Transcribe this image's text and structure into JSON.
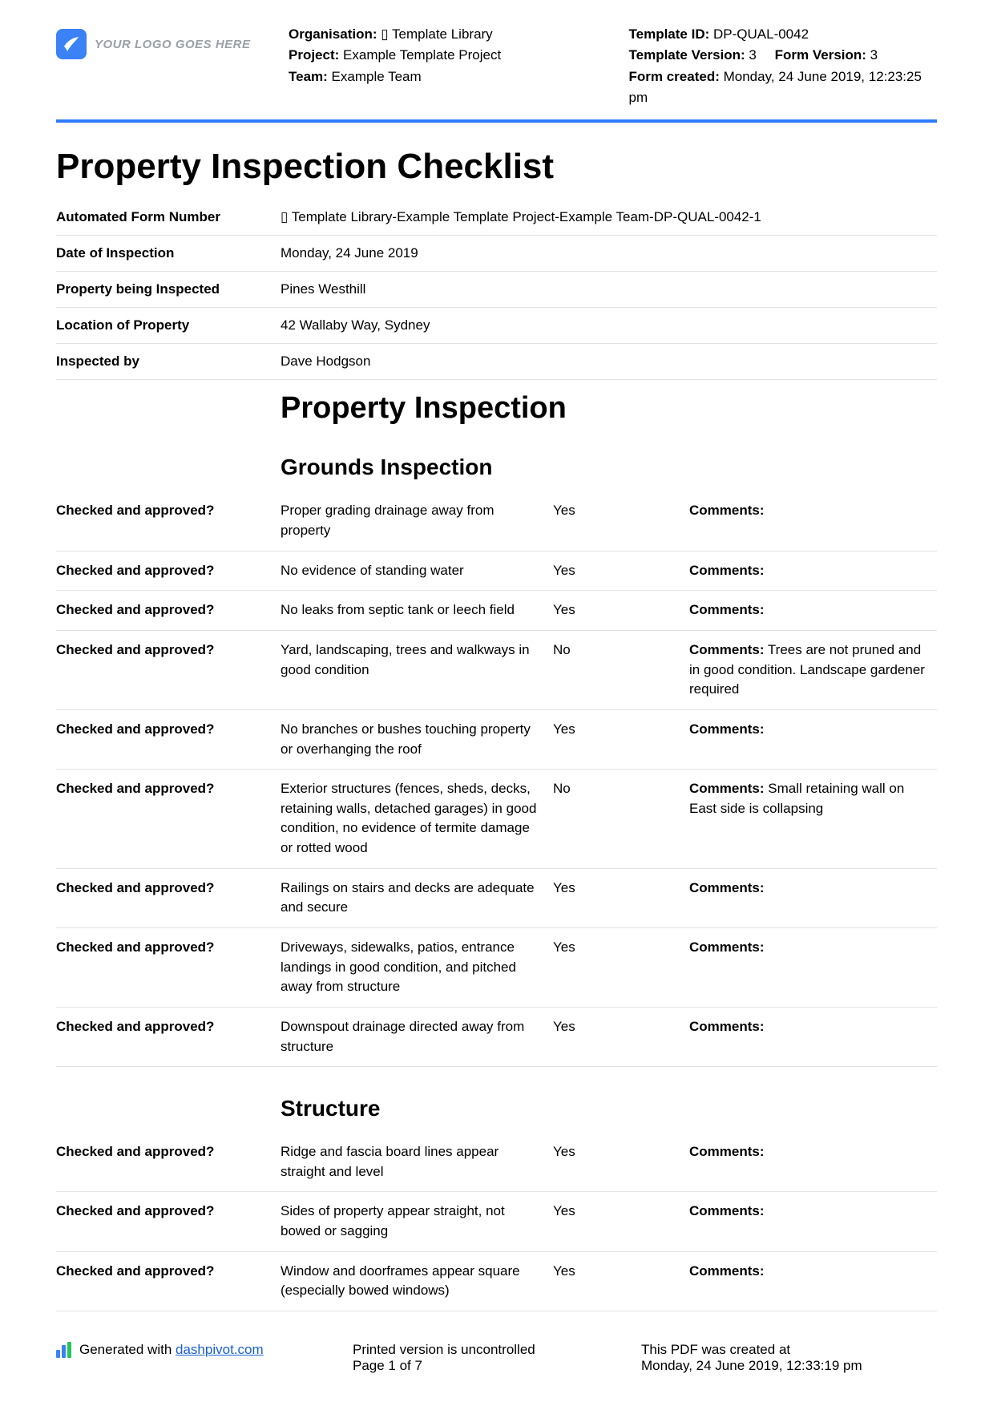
{
  "logo_text": "YOUR LOGO GOES HERE",
  "header": {
    "left": {
      "org_label": "Organisation:",
      "org_value": "▯ Template Library",
      "project_label": "Project:",
      "project_value": "Example Template Project",
      "team_label": "Team:",
      "team_value": "Example Team"
    },
    "right": {
      "tid_label": "Template ID:",
      "tid_value": "DP-QUAL-0042",
      "tver_label": "Template Version:",
      "tver_value": "3",
      "fver_label": "Form Version:",
      "fver_value": "3",
      "created_label": "Form created:",
      "created_value": "Monday, 24 June 2019, 12:23:25 pm"
    }
  },
  "page_title": "Property Inspection Checklist",
  "info": [
    {
      "label": "Automated Form Number",
      "value": "▯ Template Library-Example Template Project-Example Team-DP-QUAL-0042-1"
    },
    {
      "label": "Date of Inspection",
      "value": "Monday, 24 June 2019"
    },
    {
      "label": "Property being Inspected",
      "value": "Pines Westhill"
    },
    {
      "label": "Location of Property",
      "value": "42 Wallaby Way, Sydney"
    },
    {
      "label": "Inspected by",
      "value": "Dave Hodgson"
    }
  ],
  "section_heading": "Property Inspection",
  "q_label": "Checked and approved?",
  "comments_label": "Comments:",
  "grounds_heading": "Grounds Inspection",
  "grounds": [
    {
      "desc": "Proper grading drainage away from property",
      "answer": "Yes",
      "comment": ""
    },
    {
      "desc": "No evidence of standing water",
      "answer": "Yes",
      "comment": ""
    },
    {
      "desc": "No leaks from septic tank or leech field",
      "answer": "Yes",
      "comment": ""
    },
    {
      "desc": "Yard, landscaping, trees and walkways in good condition",
      "answer": "No",
      "comment": "Trees are not pruned and in good condition. Landscape gardener required"
    },
    {
      "desc": "No branches or bushes touching property or overhanging the roof",
      "answer": "Yes",
      "comment": ""
    },
    {
      "desc": "Exterior structures (fences, sheds, decks, retaining walls, detached garages) in good condition, no evidence of termite damage or rotted wood",
      "answer": "No",
      "comment": "Small retaining wall on East side is collapsing"
    },
    {
      "desc": "Railings on stairs and decks are adequate and secure",
      "answer": "Yes",
      "comment": ""
    },
    {
      "desc": "Driveways, sidewalks, patios, entrance landings in good condition, and pitched away from structure",
      "answer": "Yes",
      "comment": ""
    },
    {
      "desc": "Downspout drainage directed away from structure",
      "answer": "Yes",
      "comment": ""
    }
  ],
  "structure_heading": "Structure",
  "structure": [
    {
      "desc": "Ridge and fascia board lines appear straight and level",
      "answer": "Yes",
      "comment": ""
    },
    {
      "desc": "Sides of property appear straight, not bowed or sagging",
      "answer": "Yes",
      "comment": ""
    },
    {
      "desc": "Window and doorframes appear square (especially bowed windows)",
      "answer": "Yes",
      "comment": ""
    }
  ],
  "footer": {
    "gen_prefix": "Generated with ",
    "gen_link": "dashpivot.com",
    "uncontrolled": "Printed version is uncontrolled",
    "page": "Page 1 of 7",
    "created_at_label": "This PDF was created at",
    "created_at_value": "Monday, 24 June 2019, 12:33:19 pm"
  }
}
